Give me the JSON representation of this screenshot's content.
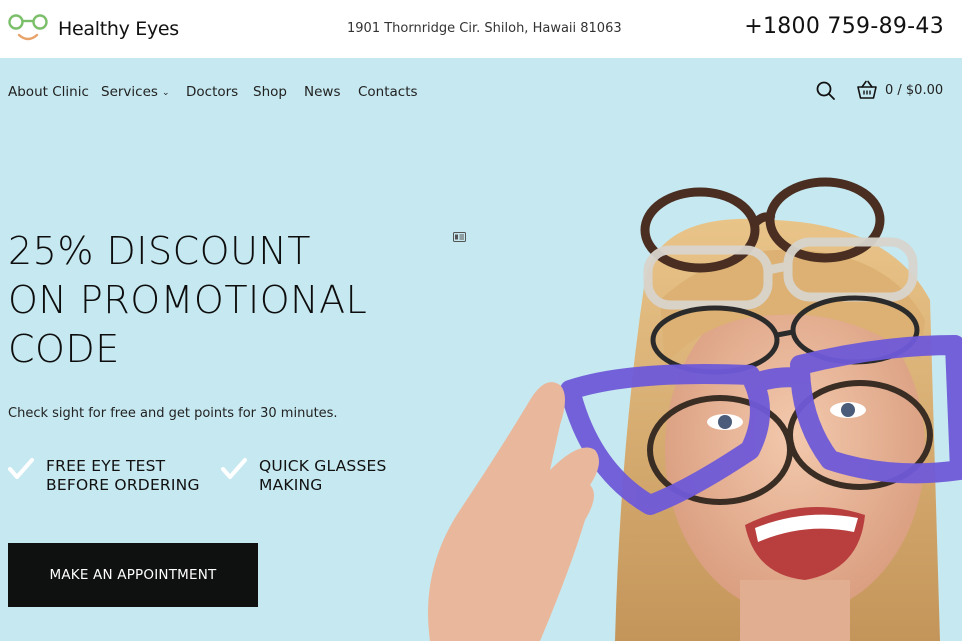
{
  "header": {
    "brand_name": "Healthy Eyes",
    "address": "1901 Thornridge Cir. Shiloh, Hawaii 81063",
    "phone": "+1800 759-89-43"
  },
  "nav": {
    "items": [
      {
        "label": "About Clinic"
      },
      {
        "label": "Services"
      },
      {
        "label": "Doctors"
      },
      {
        "label": "Shop"
      },
      {
        "label": "News"
      },
      {
        "label": "Contacts"
      }
    ],
    "cart_summary": "0 /  $0.00"
  },
  "hero": {
    "title_line1": "25% DISCOUNT",
    "title_line2": "ON PROMOTIONAL",
    "title_line3": "CODE",
    "subtitle": "Check sight for free and get points for 30 minutes.",
    "features": [
      {
        "line1": "FREE EYE TEST",
        "line2": "BEFORE ORDERING"
      },
      {
        "line1": "QUICK GLASSES",
        "line2": "MAKING"
      }
    ],
    "cta_label": "MAKE AN APPOINTMENT"
  },
  "colors": {
    "hero_background": "#c6e8f0",
    "logo_green": "#7bbf6a",
    "logo_orange": "#e8a36a",
    "button": "#0f1010"
  }
}
